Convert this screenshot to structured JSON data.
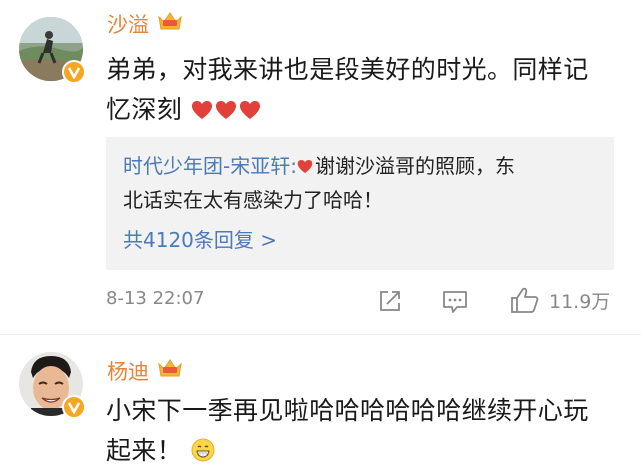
{
  "comment1": {
    "username": "沙溢",
    "text": "弟弟，对我来讲也是段美好的时光。同样记忆深刻",
    "text_line1": "弟弟，对我来讲也是段美好的时光。同样记",
    "text_line2": "忆深刻",
    "reply": {
      "author": "时代少年团-宋亚轩:",
      "text_line1": "谢谢沙溢哥的照顾，东",
      "text_line2": "北话实在太有感染力了哈哈！",
      "count_label": "共4120条回复 >"
    },
    "time": "8-13 22:07",
    "like_count": "11.9万"
  },
  "comment2": {
    "username": "杨迪",
    "text_line1": "小宋下一季再见啦哈哈哈哈哈哈继续开心玩",
    "text_line2": "起来！"
  },
  "colors": {
    "username": "#e8833a",
    "link": "#4a7ab7",
    "heart": "#e0413a",
    "verified": "#f5a623"
  },
  "icons": [
    "crown-badge-icon",
    "verified-v-icon",
    "heart-icon",
    "share-icon",
    "comment-icon",
    "like-icon",
    "grin-emoji-icon"
  ]
}
